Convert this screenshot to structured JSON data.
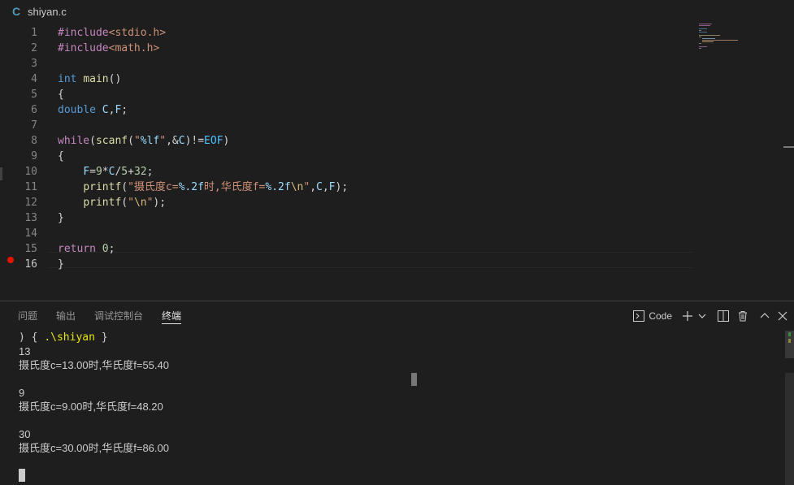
{
  "tab": {
    "icon": "C",
    "filename": "shiyan.c"
  },
  "editor": {
    "lines": [
      {
        "num": "1",
        "tokens": [
          {
            "c": "kw-pp",
            "t": "#include"
          },
          {
            "c": "str",
            "t": "<stdio.h>"
          }
        ]
      },
      {
        "num": "2",
        "tokens": [
          {
            "c": "kw-pp",
            "t": "#include"
          },
          {
            "c": "str",
            "t": "<math.h>"
          }
        ]
      },
      {
        "num": "3",
        "tokens": []
      },
      {
        "num": "4",
        "tokens": [
          {
            "c": "type",
            "t": "int"
          },
          {
            "c": "plain",
            "t": " "
          },
          {
            "c": "fn",
            "t": "main"
          },
          {
            "c": "plain",
            "t": "()"
          }
        ]
      },
      {
        "num": "5",
        "tokens": [
          {
            "c": "plain",
            "t": "{"
          }
        ]
      },
      {
        "num": "6",
        "tokens": [
          {
            "c": "type",
            "t": "double"
          },
          {
            "c": "plain",
            "t": " "
          },
          {
            "c": "var",
            "t": "C"
          },
          {
            "c": "plain",
            "t": ","
          },
          {
            "c": "var",
            "t": "F"
          },
          {
            "c": "plain",
            "t": ";"
          }
        ]
      },
      {
        "num": "7",
        "tokens": []
      },
      {
        "num": "8",
        "tokens": [
          {
            "c": "kw-pp",
            "t": "while"
          },
          {
            "c": "plain",
            "t": "("
          },
          {
            "c": "fn",
            "t": "scanf"
          },
          {
            "c": "plain",
            "t": "("
          },
          {
            "c": "str",
            "t": "\""
          },
          {
            "c": "var",
            "t": "%lf"
          },
          {
            "c": "str",
            "t": "\""
          },
          {
            "c": "plain",
            "t": ",&"
          },
          {
            "c": "var",
            "t": "C"
          },
          {
            "c": "plain",
            "t": ")!="
          },
          {
            "c": "const",
            "t": "EOF"
          },
          {
            "c": "plain",
            "t": ")"
          }
        ]
      },
      {
        "num": "9",
        "tokens": [
          {
            "c": "plain",
            "t": "{"
          }
        ]
      },
      {
        "num": "10",
        "tokens": [
          {
            "c": "plain",
            "t": "    "
          },
          {
            "c": "var",
            "t": "F"
          },
          {
            "c": "plain",
            "t": "="
          },
          {
            "c": "num",
            "t": "9"
          },
          {
            "c": "plain",
            "t": "*"
          },
          {
            "c": "var",
            "t": "C"
          },
          {
            "c": "plain",
            "t": "/"
          },
          {
            "c": "num",
            "t": "5"
          },
          {
            "c": "plain",
            "t": "+"
          },
          {
            "c": "num",
            "t": "32"
          },
          {
            "c": "plain",
            "t": ";"
          }
        ]
      },
      {
        "num": "11",
        "tokens": [
          {
            "c": "plain",
            "t": "    "
          },
          {
            "c": "fn",
            "t": "printf"
          },
          {
            "c": "plain",
            "t": "("
          },
          {
            "c": "str",
            "t": "\"摄氏度c="
          },
          {
            "c": "var",
            "t": "%.2f"
          },
          {
            "c": "str",
            "t": "时,华氏度f="
          },
          {
            "c": "var",
            "t": "%.2f"
          },
          {
            "c": "esc",
            "t": "\\n"
          },
          {
            "c": "str",
            "t": "\""
          },
          {
            "c": "plain",
            "t": ","
          },
          {
            "c": "var",
            "t": "C"
          },
          {
            "c": "plain",
            "t": ","
          },
          {
            "c": "var",
            "t": "F"
          },
          {
            "c": "plain",
            "t": ");"
          }
        ]
      },
      {
        "num": "12",
        "tokens": [
          {
            "c": "plain",
            "t": "    "
          },
          {
            "c": "fn",
            "t": "printf"
          },
          {
            "c": "plain",
            "t": "("
          },
          {
            "c": "str",
            "t": "\""
          },
          {
            "c": "esc",
            "t": "\\n"
          },
          {
            "c": "str",
            "t": "\""
          },
          {
            "c": "plain",
            "t": ");"
          }
        ]
      },
      {
        "num": "13",
        "tokens": [
          {
            "c": "plain",
            "t": "}"
          }
        ]
      },
      {
        "num": "14",
        "tokens": []
      },
      {
        "num": "15",
        "tokens": [
          {
            "c": "kw-pp",
            "t": "return"
          },
          {
            "c": "plain",
            "t": " "
          },
          {
            "c": "num",
            "t": "0"
          },
          {
            "c": "plain",
            "t": ";"
          }
        ]
      },
      {
        "num": "16",
        "tokens": [
          {
            "c": "plain",
            "t": "}"
          }
        ]
      }
    ]
  },
  "panel": {
    "tabs": {
      "problems": "问题",
      "output": "输出",
      "debug_console": "调试控制台",
      "terminal": "终端"
    },
    "actions": {
      "shell_label": "Code"
    }
  },
  "terminal": {
    "prompt_prefix": ") { ",
    "prompt_cmd": ".\\shiyan",
    "prompt_suffix": " }",
    "lines": [
      "13",
      "摄氏度c=13.00时,华氏度f=55.40",
      "",
      "9",
      "摄氏度c=9.00时,华氏度f=48.20",
      "",
      "30",
      "摄氏度c=30.00时,华氏度f=86.00"
    ]
  }
}
